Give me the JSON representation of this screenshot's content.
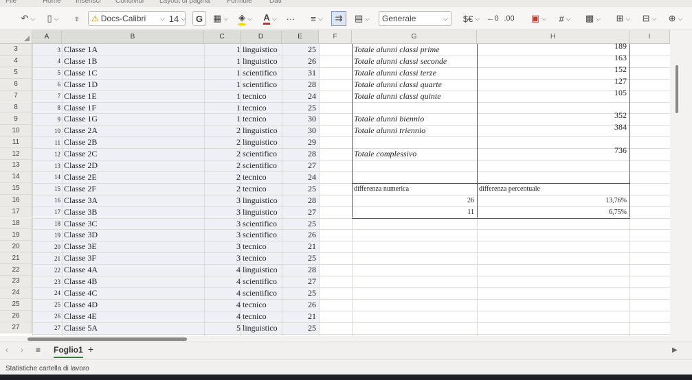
{
  "menu": [
    "File",
    "Home",
    "Inserisci",
    "Condividi",
    "Layout di pagina",
    "Formule",
    "Dati"
  ],
  "toolbar": {
    "font_name": "Docs-Calibri",
    "font_size": "14",
    "bold_label": "G",
    "number_format": "Generale",
    "currency_label": "$€",
    "more_label": "···"
  },
  "columns": [
    "A",
    "B",
    "C",
    "D",
    "E",
    "F",
    "G",
    "H",
    "I"
  ],
  "rows": [
    {
      "n": "3",
      "a": "3",
      "b": "Classe 1A",
      "c": "1",
      "d": "linguistico",
      "e": "25"
    },
    {
      "n": "4",
      "a": "4",
      "b": "Classe 1B",
      "c": "1",
      "d": "linguistico",
      "e": "26"
    },
    {
      "n": "5",
      "a": "5",
      "b": "Classe 1C",
      "c": "1",
      "d": "scientifico",
      "e": "31"
    },
    {
      "n": "6",
      "a": "6",
      "b": "Classe 1D",
      "c": "1",
      "d": "scientifico",
      "e": "28"
    },
    {
      "n": "7",
      "a": "7",
      "b": "Classe 1E",
      "c": "1",
      "d": "tecnico",
      "e": "24"
    },
    {
      "n": "8",
      "a": "8",
      "b": "Classe 1F",
      "c": "1",
      "d": "tecnico",
      "e": "25"
    },
    {
      "n": "9",
      "a": "9",
      "b": "Classe 1G",
      "c": "1",
      "d": "tecnico",
      "e": "30"
    },
    {
      "n": "10",
      "a": "10",
      "b": "Classe 2A",
      "c": "2",
      "d": "linguistico",
      "e": "30"
    },
    {
      "n": "11",
      "a": "11",
      "b": "Classe 2B",
      "c": "2",
      "d": "linguistico",
      "e": "29"
    },
    {
      "n": "12",
      "a": "12",
      "b": "Classe 2C",
      "c": "2",
      "d": "scientifico",
      "e": "28"
    },
    {
      "n": "13",
      "a": "13",
      "b": "Classe 2D",
      "c": "2",
      "d": "scientifico",
      "e": "27"
    },
    {
      "n": "14",
      "a": "14",
      "b": "Classe 2E",
      "c": "2",
      "d": "tecnico",
      "e": "24"
    },
    {
      "n": "15",
      "a": "15",
      "b": "Classe 2F",
      "c": "2",
      "d": "tecnico",
      "e": "25"
    },
    {
      "n": "16",
      "a": "16",
      "b": "Classe 3A",
      "c": "3",
      "d": "linguistico",
      "e": "28"
    },
    {
      "n": "17",
      "a": "17",
      "b": "Classe 3B",
      "c": "3",
      "d": "linguistico",
      "e": "27"
    },
    {
      "n": "18",
      "a": "18",
      "b": "Classe 3C",
      "c": "3",
      "d": "scientifico",
      "e": "25"
    },
    {
      "n": "19",
      "a": "19",
      "b": "Classe 3D",
      "c": "3",
      "d": "scientifico",
      "e": "26"
    },
    {
      "n": "20",
      "a": "20",
      "b": "Classe 3E",
      "c": "3",
      "d": "tecnico",
      "e": "21"
    },
    {
      "n": "21",
      "a": "21",
      "b": "Classe 3F",
      "c": "3",
      "d": "tecnico",
      "e": "25"
    },
    {
      "n": "22",
      "a": "22",
      "b": "Classe 4A",
      "c": "4",
      "d": "linguistico",
      "e": "28"
    },
    {
      "n": "23",
      "a": "23",
      "b": "Classe 4B",
      "c": "4",
      "d": "scientifico",
      "e": "27"
    },
    {
      "n": "24",
      "a": "24",
      "b": "Classe 4C",
      "c": "4",
      "d": "scientifico",
      "e": "25"
    },
    {
      "n": "25",
      "a": "25",
      "b": "Classe 4D",
      "c": "4",
      "d": "tecnico",
      "e": "26"
    },
    {
      "n": "26",
      "a": "26",
      "b": "Classe 4E",
      "c": "4",
      "d": "tecnico",
      "e": "21"
    },
    {
      "n": "27",
      "a": "27",
      "b": "Classe 5A",
      "c": "5",
      "d": "linguistico",
      "e": "25"
    }
  ],
  "summary": [
    {
      "row": 0,
      "label": "Totale alunni classi prime",
      "value": "189"
    },
    {
      "row": 1,
      "label": "Totale alunni classi seconde",
      "value": "163"
    },
    {
      "row": 2,
      "label": "Totale alunni classi terze",
      "value": "152"
    },
    {
      "row": 3,
      "label": "Totale alunni classi quarte",
      "value": "127"
    },
    {
      "row": 4,
      "label": "Totale alunni classi quinte",
      "value": "105"
    },
    {
      "row": 6,
      "label": "Totale alunni biennio",
      "value": "352"
    },
    {
      "row": 7,
      "label": "Totale alunni triennio",
      "value": "384"
    },
    {
      "row": 9,
      "label": "Totale complessivo",
      "value": "736"
    }
  ],
  "diff": {
    "label_num": "differenza numerica",
    "label_pct": "differenza percentuale",
    "num1": "26",
    "pct1": "13,76%",
    "num2": "11",
    "pct2": "6,75%"
  },
  "sheet_tab": "Foglio1",
  "add_sheet": "+",
  "status": "Statistiche cartella di lavoro"
}
